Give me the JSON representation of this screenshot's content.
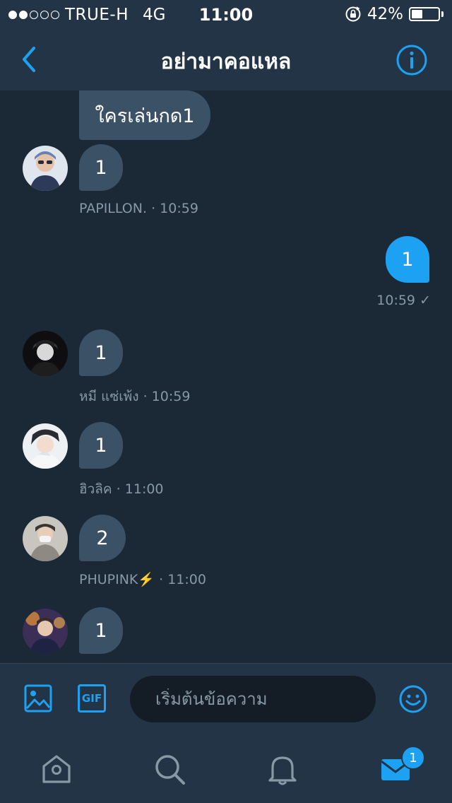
{
  "status_bar": {
    "carrier": "TRUE-H",
    "network": "4G",
    "time": "11:00",
    "battery": "42%",
    "battery_level": 0.42,
    "signal_bars": 2
  },
  "header": {
    "title": "อย่ามาคอแหล",
    "back_icon": "chevron-left-icon",
    "info_icon": "info-icon"
  },
  "messages": {
    "top_bubble": "ใครเล่นกด1",
    "m1": {
      "text": "1",
      "sender": "PAPILLON.",
      "time": "10:59"
    },
    "sent": {
      "text": "1",
      "time": "10:59",
      "status": "✓"
    },
    "m2": {
      "text": "1",
      "sender": "หมี แซ่เพ้ง",
      "time": "10:59"
    },
    "m3": {
      "text": "1",
      "sender": "ฮิวลิค",
      "time": "11:00"
    },
    "m4": {
      "text": "2",
      "sender": "PHUPINK⚡️",
      "time": "11:00"
    },
    "m5": {
      "text": "1"
    },
    "separator": "·"
  },
  "composer": {
    "placeholder": "เริ่มต้นข้อความ",
    "gif_label": "GIF",
    "image_icon": "image-icon",
    "emoji_icon": "smiley-icon"
  },
  "tabbar": {
    "items": [
      "home-icon",
      "search-icon",
      "bell-icon",
      "mail-icon"
    ],
    "messages_badge": "1"
  },
  "colors": {
    "accent": "#1da1f2",
    "background": "#1b2836",
    "bar": "#243447",
    "bubble_received": "#3b5165",
    "muted": "#8899a6"
  }
}
